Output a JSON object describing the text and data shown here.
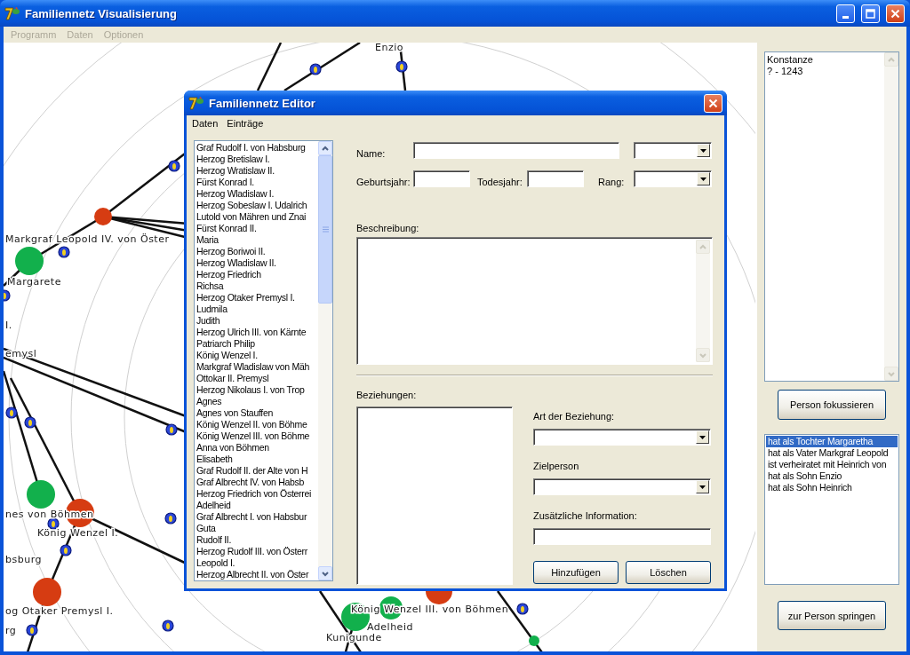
{
  "window": {
    "title": "Familiennetz Visualisierung"
  },
  "menu": [
    {
      "label": "Programm",
      "disabled": true
    },
    {
      "label": "Daten",
      "disabled": true
    },
    {
      "label": "Optionen",
      "disabled": true
    }
  ],
  "graph": {
    "nodes": [
      {
        "color": "#d63c12"
      },
      {
        "color": "#12b04c"
      },
      {
        "color": "#12b04c"
      },
      {
        "color": "#d63c12"
      },
      {
        "color": "#d63c12"
      },
      {
        "color": "#12b04c"
      },
      {
        "color": "#12b04c"
      },
      {
        "color": "#d63c12"
      },
      {
        "color": "#12b04c"
      }
    ],
    "labels": [
      "Enzio",
      "Markgraf Leopold IV. von Öster",
      "Margarete",
      "I.",
      "emysl",
      "nes von Böhmen",
      "König Wenzel I.",
      "bsburg",
      "og Otaker Premysl I.",
      "rg",
      "König Wenzel III. von Böhmen",
      "Adelheid",
      "Kunigunde"
    ]
  },
  "side": {
    "info_lines": [
      "Konstanze",
      "? - 1243"
    ],
    "focus_button": "Person fokussieren",
    "relations": [
      {
        "label": "hat als Tochter Margaretha",
        "selected": true
      },
      {
        "label": "hat als Vater Markgraf Leopold",
        "selected": false
      },
      {
        "label": "ist verheiratet mit Heinrich von",
        "selected": false
      },
      {
        "label": "hat als Sohn Enzio",
        "selected": false
      },
      {
        "label": "hat als Sohn Heinrich",
        "selected": false
      }
    ],
    "jump_button": "zur Person springen"
  },
  "editor": {
    "title": "Familiennetz Editor",
    "menu": [
      "Daten",
      "Einträge"
    ],
    "people": [
      {
        "label": "Graf Rudolf I. von Habsburg",
        "selected": false
      },
      {
        "label": "Herzog Bretislaw I.",
        "selected": false
      },
      {
        "label": "Herzog Wratislaw II.",
        "selected": false
      },
      {
        "label": "Fürst Konrad I.",
        "selected": false
      },
      {
        "label": "Herzog Wladislaw I.",
        "selected": false
      },
      {
        "label": "Herzog Sobeslaw I. Udalrich",
        "selected": false
      },
      {
        "label": "Lutold von Mähren und Znai",
        "selected": false
      },
      {
        "label": "Fürst Konrad II.",
        "selected": false
      },
      {
        "label": "Maria",
        "selected": false
      },
      {
        "label": "Herzog Boriwoi II.",
        "selected": false
      },
      {
        "label": "Herzog Wladislaw II.",
        "selected": false
      },
      {
        "label": "Herzog Friedrich",
        "selected": false
      },
      {
        "label": "Richsa",
        "selected": false
      },
      {
        "label": "Herzog Otaker Premysl I.",
        "selected": false
      },
      {
        "label": "Ludmila",
        "selected": false
      },
      {
        "label": "Judith",
        "selected": false
      },
      {
        "label": "Herzog Ulrich III. von Kärnte",
        "selected": false
      },
      {
        "label": "Patriarch Philip",
        "selected": false
      },
      {
        "label": "König Wenzel I.",
        "selected": false
      },
      {
        "label": "Markgraf Wladislaw von Mäh",
        "selected": false
      },
      {
        "label": "Ottokar II. Premysl",
        "selected": false
      },
      {
        "label": "Herzog Nikolaus I. von Trop",
        "selected": false
      },
      {
        "label": "Agnes",
        "selected": false
      },
      {
        "label": "Agnes von Stauffen",
        "selected": false
      },
      {
        "label": "König Wenzel II. von Böhme",
        "selected": false
      },
      {
        "label": "König Wenzel III. von Böhme",
        "selected": false
      },
      {
        "label": "Anna von Böhmen",
        "selected": false
      },
      {
        "label": "Elisabeth",
        "selected": false
      },
      {
        "label": "Graf Rudolf II. der Alte von H",
        "selected": false
      },
      {
        "label": "Graf Albrecht IV. von Habsb",
        "selected": false
      },
      {
        "label": "Herzog Friedrich von Österrei",
        "selected": false
      },
      {
        "label": "Adelheid",
        "selected": false
      },
      {
        "label": "Graf Albrecht I. von Habsbur",
        "selected": false
      },
      {
        "label": "Guta",
        "selected": false
      },
      {
        "label": "Rudolf II.",
        "selected": false
      },
      {
        "label": "Herzog Rudolf III. von Österr",
        "selected": false
      },
      {
        "label": "Leopold I.",
        "selected": false
      },
      {
        "label": "Herzog Albrecht II. von Öster",
        "selected": false
      }
    ],
    "labels": {
      "name": "Name:",
      "birth": "Geburtsjahr:",
      "death": "Todesjahr:",
      "rank": "Rang:",
      "description": "Beschreibung:",
      "relations": "Beziehungen:",
      "relation_type": "Art der Beziehung:",
      "target": "Zielperson",
      "info": "Zusätzliche Information:"
    },
    "buttons": [
      "Hinzufügen",
      "Löschen"
    ]
  }
}
